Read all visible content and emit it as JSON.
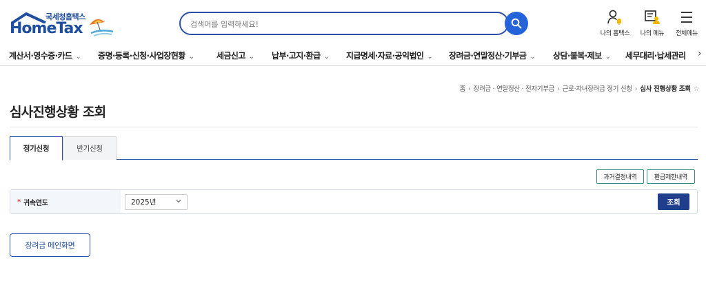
{
  "header": {
    "logo_sub": "국세청홈택스",
    "logo_main": "HomeTax",
    "search": {
      "placeholder": "검색어를 입력하세요!"
    },
    "util": {
      "my_hometax": "나의 홈택스",
      "my_menu": "나의 메뉴",
      "all_menu": "전체메뉴"
    }
  },
  "nav": {
    "items": [
      {
        "label": "계산서·영수증·카드"
      },
      {
        "label": "증명·등록·신청·사업장현황"
      },
      {
        "label": "세금신고"
      },
      {
        "label": "납부·고지·환급"
      },
      {
        "label": "지급명세·자료·공익법인"
      },
      {
        "label": "장려금·연말정산·기부금"
      },
      {
        "label": "상담·불복·제보"
      },
      {
        "label": "세무대리·납세관리"
      }
    ],
    "chevron": "⌄",
    "more_arrow": "›"
  },
  "breadcrumb": {
    "items": [
      "홈",
      "장려금 · 연말정산 · 전자기부금",
      "근로·자녀장려금 정기 신청"
    ],
    "current": "심사 진행상황 조회",
    "separator": "›",
    "star": "☆"
  },
  "page": {
    "title": "심사진행상황 조회"
  },
  "tabs": [
    {
      "label": "정기신청",
      "active": true
    },
    {
      "label": "반기신청",
      "active": false
    }
  ],
  "actions": {
    "past_decision": "과거결정내역",
    "refund_limit": "환급제한내역"
  },
  "form": {
    "required_mark": "*",
    "year_label": "귀속연도",
    "year_value": "2025년",
    "search_button": "조회"
  },
  "footer": {
    "main_button": "장려금 메인화면"
  },
  "colors": {
    "brand_blue": "#1f4ea1",
    "primary_button": "#1f3f8c",
    "search_button": "#2563d9",
    "required": "#e03c3c"
  }
}
